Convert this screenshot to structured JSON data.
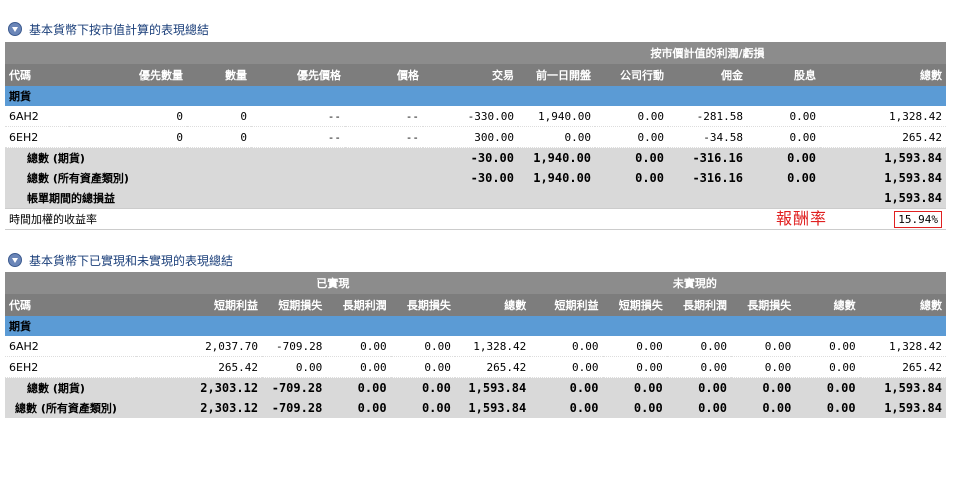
{
  "section1": {
    "title": "基本貨幣下按市值計算的表現總結",
    "group_label": "按市價計值的利潤/虧損",
    "columns": [
      "代碼",
      "優先數量",
      "數量",
      "優先價格",
      "價格",
      "交易",
      "前一日開盤",
      "公司行動",
      "佣金",
      "股息",
      "總數"
    ],
    "category": "期貨",
    "rows": [
      [
        "6AH2",
        "0",
        "0",
        "--",
        "--",
        "-330.00",
        "1,940.00",
        "0.00",
        "-281.58",
        "0.00",
        "1,328.42"
      ],
      [
        "6EH2",
        "0",
        "0",
        "--",
        "--",
        "300.00",
        "0.00",
        "0.00",
        "-34.58",
        "0.00",
        "265.42"
      ]
    ],
    "total_futures": {
      "label": "總數 (期貨)",
      "values": [
        "-30.00",
        "1,940.00",
        "0.00",
        "-316.16",
        "0.00",
        "1,593.84"
      ]
    },
    "total_all": {
      "label": "總數 (所有資產類別)",
      "values": [
        "-30.00",
        "1,940.00",
        "0.00",
        "-316.16",
        "0.00",
        "1,593.84"
      ]
    },
    "period_total": {
      "label": "帳單期間的總損益",
      "value": "1,593.84"
    },
    "twr": {
      "label": "時間加權的收益率",
      "value": "15.94%"
    },
    "annotation": "報酬率"
  },
  "section2": {
    "title": "基本貨幣下已實現和未實現的表現總結",
    "group_realized": "已實現",
    "group_unrealized": "未實現的",
    "columns": [
      "代碼",
      "短期利益",
      "短期損失",
      "長期利潤",
      "長期損失",
      "總數",
      "短期利益",
      "短期損失",
      "長期利潤",
      "長期損失",
      "總數",
      "總數"
    ],
    "category": "期貨",
    "rows": [
      [
        "6AH2",
        "2,037.70",
        "-709.28",
        "0.00",
        "0.00",
        "1,328.42",
        "0.00",
        "0.00",
        "0.00",
        "0.00",
        "0.00",
        "1,328.42"
      ],
      [
        "6EH2",
        "265.42",
        "0.00",
        "0.00",
        "0.00",
        "265.42",
        "0.00",
        "0.00",
        "0.00",
        "0.00",
        "0.00",
        "265.42"
      ]
    ],
    "total_futures": {
      "label": "總數 (期貨)",
      "values": [
        "2,303.12",
        "-709.28",
        "0.00",
        "0.00",
        "1,593.84",
        "0.00",
        "0.00",
        "0.00",
        "0.00",
        "0.00",
        "1,593.84"
      ]
    },
    "total_all": {
      "label": "總數 (所有資產類別)",
      "values": [
        "2,303.12",
        "-709.28",
        "0.00",
        "0.00",
        "1,593.84",
        "0.00",
        "0.00",
        "0.00",
        "0.00",
        "0.00",
        "1,593.84"
      ]
    }
  },
  "colors": {
    "header_gray": "#7d7d7d",
    "category_blue": "#5b9bd5",
    "total_gray": "#d9d9d9",
    "annotation_red": "#e02020",
    "title_blue": "#1b3f7a"
  },
  "icons": {
    "section_toggle": "chevron-down-circle-icon"
  }
}
